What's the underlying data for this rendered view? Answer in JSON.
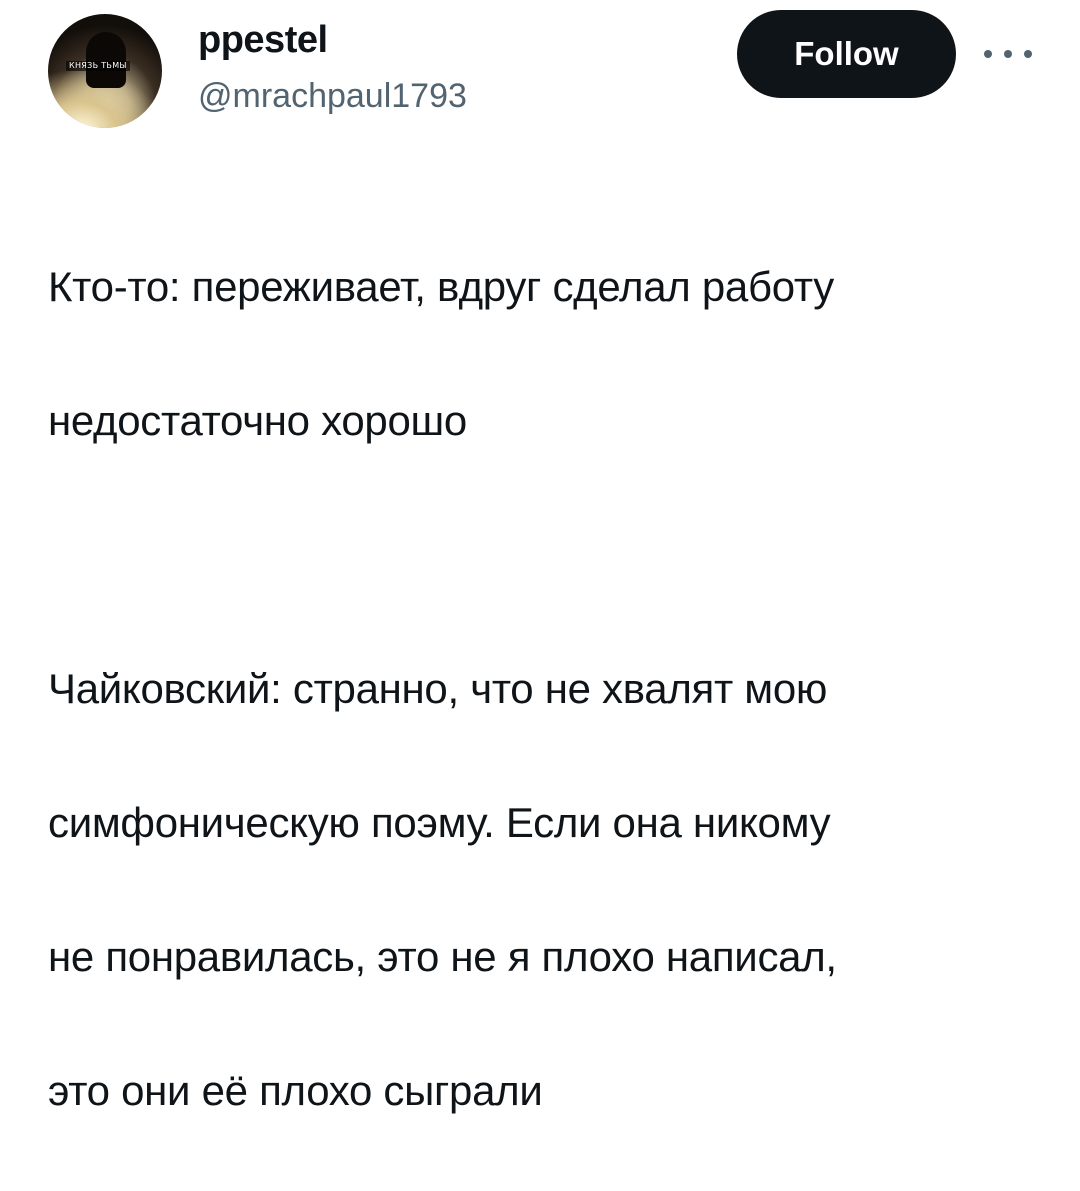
{
  "author": {
    "display_name": "ppestel",
    "handle": "@mrachpaul1793",
    "avatar_badge": "КНЯЗЬ ТЬМЫ"
  },
  "actions": {
    "follow_label": "Follow",
    "more_icon": "more-horizontal-icon"
  },
  "tweet": {
    "lines": [
      "Кто-то: переживает, вдруг сделал работу",
      "недостаточно хорошо",
      "",
      "Чайковский: странно, что не хвалят мою",
      "симфоническую поэму. Если она никому",
      "не понравилась, это не я плохо написал,",
      "это они её плохо сыграли"
    ]
  },
  "colors": {
    "text_primary": "#0f1419",
    "text_secondary": "#536471",
    "button_bg": "#0f1419",
    "button_text": "#ffffff"
  }
}
